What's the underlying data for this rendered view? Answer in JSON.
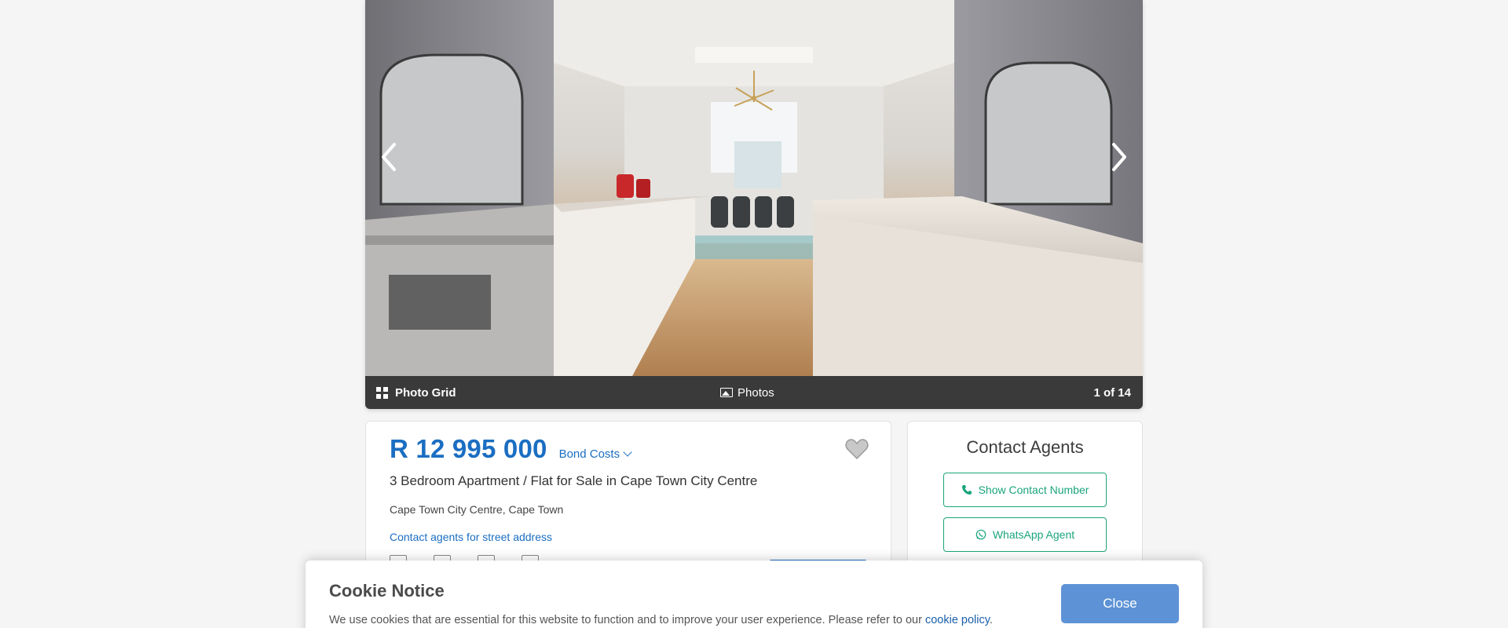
{
  "gallery": {
    "photo_alt": "Kitchen and dining area",
    "photo_grid_label": "Photo Grid",
    "photos_label": "Photos",
    "counter": "1 of 14",
    "prev_icon": "chevron-left-icon",
    "next_icon": "chevron-right-icon"
  },
  "listing": {
    "price": "R 12 995 000",
    "bond_costs_label": "Bond Costs",
    "title": "3 Bedroom Apartment / Flat for Sale in Cape Town City Centre",
    "suburb": "Cape Town City Centre, Cape Town",
    "street_address_link": "Contact agents for street address",
    "favourite_icon": "heart-icon"
  },
  "contact": {
    "title": "Contact Agents",
    "show_number_label": "Show Contact Number",
    "whatsapp_label": "WhatsApp Agent",
    "accent_color": "#1aa57c"
  },
  "cookie_notice": {
    "title": "Cookie Notice",
    "text": "We use cookies that are essential for this website to function and to improve your user experience. Please refer to our ",
    "link_text": "cookie policy",
    "text_end": ".",
    "close_label": "Close"
  },
  "colors": {
    "brand_blue": "#1b6ec2",
    "close_button": "#5d93d6",
    "gallery_bar": "#3a3a3a"
  }
}
